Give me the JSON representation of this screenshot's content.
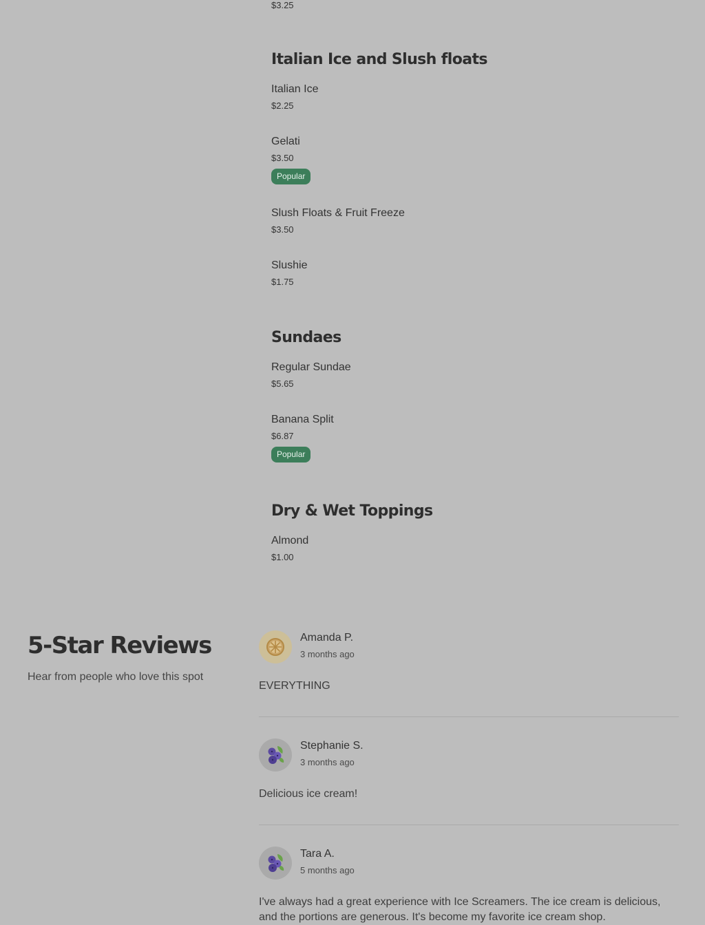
{
  "menu": {
    "top_price": "$3.25",
    "sections": [
      {
        "title": "Italian Ice and Slush floats",
        "items": [
          {
            "name": "Italian Ice",
            "price": "$2.25"
          },
          {
            "name": "Gelati",
            "price": "$3.50",
            "badge": "Popular"
          },
          {
            "name": "Slush Floats & Fruit Freeze",
            "price": "$3.50"
          },
          {
            "name": "Slushie",
            "price": "$1.75"
          }
        ]
      },
      {
        "title": "Sundaes",
        "items": [
          {
            "name": "Regular Sundae",
            "price": "$5.65"
          },
          {
            "name": "Banana Split",
            "price": "$6.87",
            "badge": "Popular"
          }
        ]
      },
      {
        "title": "Dry & Wet Toppings",
        "items": [
          {
            "name": "Almond",
            "price": "$1.00"
          }
        ]
      }
    ]
  },
  "reviews": {
    "title": "5-Star Reviews",
    "subtitle": "Hear from people who love this spot",
    "items": [
      {
        "name": "Amanda P.",
        "time": "3 months ago",
        "text": "EVERYTHING",
        "avatar_icon": "orange-slice-icon"
      },
      {
        "name": "Stephanie S.",
        "time": "3 months ago",
        "text": "Delicious ice cream!",
        "avatar_icon": "blueberries-icon"
      },
      {
        "name": "Tara A.",
        "time": "5 months ago",
        "text": "I've always had a great experience with Ice Screamers. The ice cream is delicious, and the portions are generous. It's become my favorite ice cream shop.",
        "avatar_icon": "blueberries-icon"
      }
    ]
  },
  "colors": {
    "background": "#bdbdbd",
    "badge": "#3c7e5a",
    "text": "#2b2b2b"
  }
}
